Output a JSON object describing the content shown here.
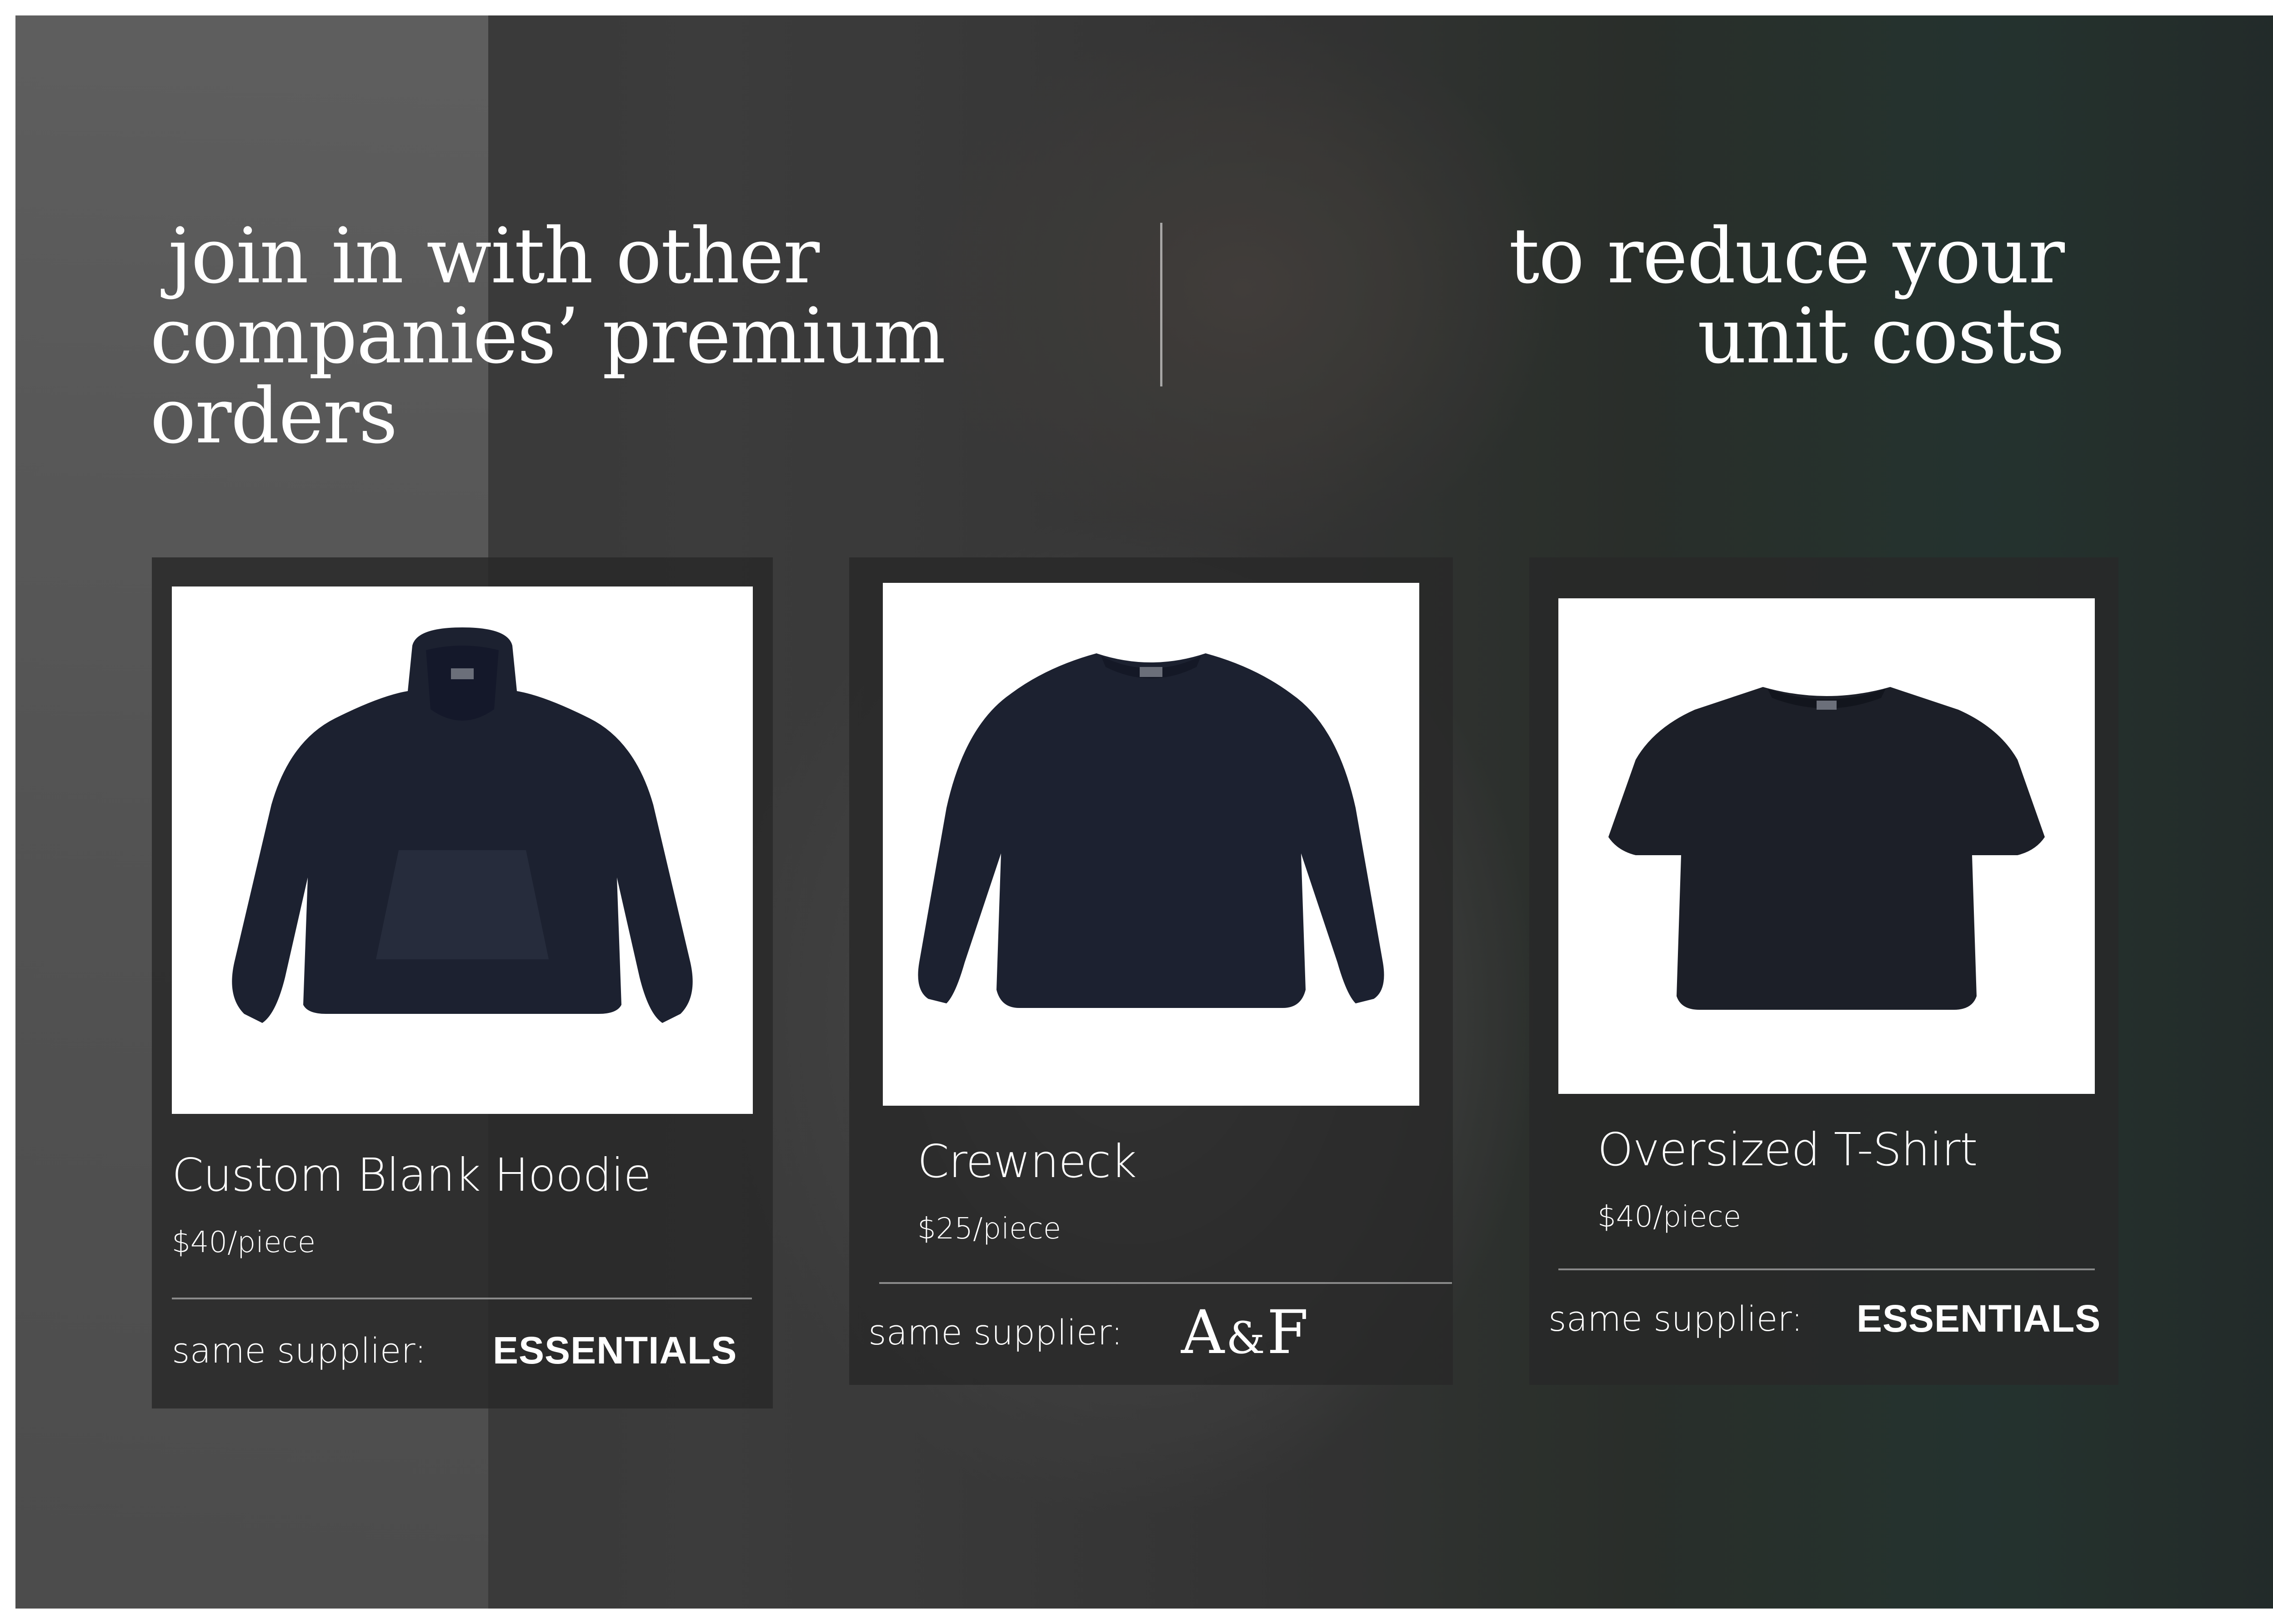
{
  "headline": {
    "left_line1": "join in with other",
    "left_line2": "companies’ premium orders",
    "right_line1": "to reduce your",
    "right_line2": "unit costs"
  },
  "products": [
    {
      "name": "Custom Blank Hoodie",
      "price": "$40/piece",
      "supplier_label": "same supplier:",
      "supplier_brand": "ESSENTIALS",
      "icon": "hoodie-icon"
    },
    {
      "name": "Crewneck",
      "price": "$25/piece",
      "supplier_label": "same supplier:",
      "supplier_brand_a": "A",
      "supplier_brand_amp": "&",
      "supplier_brand_f": "F",
      "icon": "crewneck-icon"
    },
    {
      "name": "Oversized T-Shirt",
      "price": "$40/piece",
      "supplier_label": "same supplier:",
      "supplier_brand": "ESSENTIALS",
      "icon": "tshirt-icon"
    }
  ],
  "colors": {
    "garment": "#1c2130",
    "card_bg": "rgba(40,40,40,0.82)",
    "text": "#ffffff"
  }
}
